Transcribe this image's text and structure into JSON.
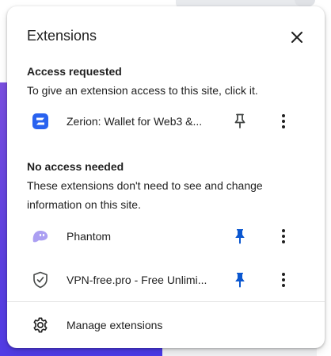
{
  "popup": {
    "title": "Extensions",
    "close_icon": "close-icon"
  },
  "access_requested": {
    "heading": "Access requested",
    "description": "To give an extension access to this site, click it.",
    "items": [
      {
        "name": "Zerion: Wallet for Web3 &...",
        "icon": "zerion-logo-icon",
        "pinned": false
      }
    ]
  },
  "no_access_needed": {
    "heading": "No access needed",
    "description": "These extensions don't need to see and change information on this site.",
    "items": [
      {
        "name": "Phantom",
        "icon": "phantom-ghost-icon",
        "pinned": true
      },
      {
        "name": "VPN-free.pro - Free Unlimi...",
        "icon": "shield-check-icon",
        "pinned": true
      }
    ]
  },
  "footer": {
    "manage_label": "Manage extensions",
    "manage_icon": "gear-icon"
  },
  "colors": {
    "pinned": "#0b57d0",
    "unpinned": "#444746",
    "zerion": "#2962ef",
    "phantom": "#ab9ff2"
  }
}
